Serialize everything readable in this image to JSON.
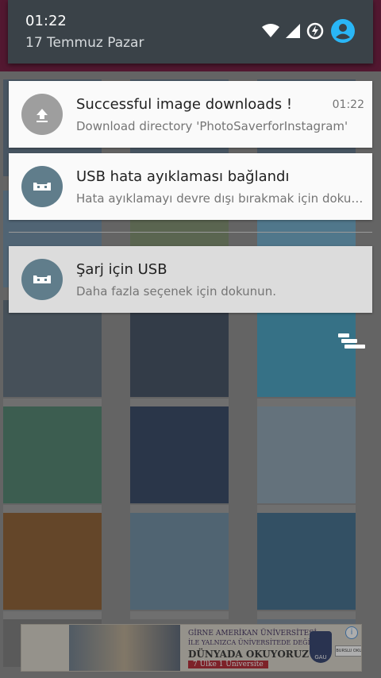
{
  "status_bar": {
    "time": "01:22",
    "date": "17 Temmuz Pazar",
    "icons": [
      "wifi-icon",
      "cell-signal-icon",
      "data-saver-icon",
      "account-icon"
    ]
  },
  "notifications": [
    {
      "title": "Successful image downloads !",
      "body": "Download directory 'PhotoSaverforInstagram'",
      "time": "01:22",
      "icon": "upload-icon",
      "icon_color": "#9e9e9e"
    },
    {
      "title": "USB hata ayıklaması bağlandı",
      "body": "Hata ayıklamayı devre dışı bırakmak için dokunun.",
      "icon": "android-debug-icon",
      "icon_color": "#607d8b"
    },
    {
      "title": "Şarj için USB",
      "body": "Daha fazla seçenek için dokunun.",
      "icon": "android-debug-icon",
      "icon_color": "#607d8b"
    }
  ],
  "ad": {
    "line1": "GİRNE AMERİKAN ÜNİVERSİTESİ",
    "line2": "İLE YALNIZCA ÜNİVERSİTEDE DEĞİL",
    "line3": "DÜNYADA OKUYORUZ",
    "line4": "7 Ülke 1 Üniversite",
    "crest_text": "GAU",
    "button_text": "BURSLU OKUMAK",
    "info_icon": "info-icon"
  },
  "colors": {
    "header_bg": "#3a4248",
    "accent": "#29b6f6",
    "app_bar": "#6e1038"
  }
}
